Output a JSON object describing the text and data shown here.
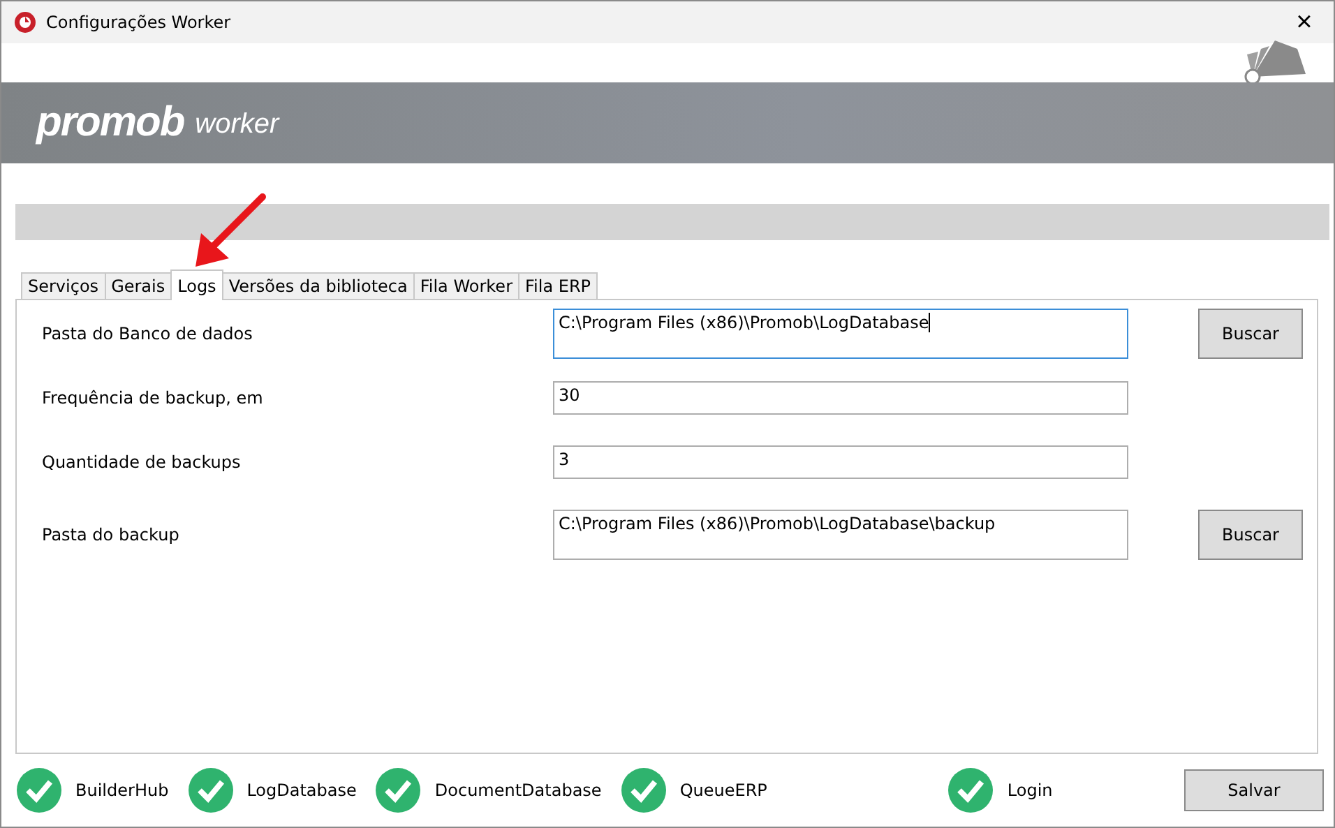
{
  "window": {
    "title": "Configurações Worker",
    "close": "×"
  },
  "banner": {
    "logo": "promob",
    "product": "worker"
  },
  "progress": {
    "level": 0
  },
  "tabs": [
    {
      "label": "Serviços",
      "selected": false
    },
    {
      "label": "Gerais",
      "selected": false
    },
    {
      "label": "Logs",
      "selected": true
    },
    {
      "label": "Versões da biblioteca",
      "selected": false
    },
    {
      "label": "Fila Worker",
      "selected": false
    },
    {
      "label": "Fila ERP",
      "selected": false
    }
  ],
  "fields": [
    {
      "label": "Pasta do Banco de dados",
      "value": "C:\\Program Files (x86)\\Promob\\LogDatabase",
      "focused": true,
      "tall": true,
      "button": "Buscar"
    },
    {
      "label": "Frequência de backup, em",
      "value": "30",
      "focused": false,
      "tall": false
    },
    {
      "label": "Quantidade de backups",
      "value": "3",
      "focused": false,
      "tall": false
    },
    {
      "label": "Pasta do backup",
      "value": "C:\\Program Files (x86)\\Promob\\LogDatabase\\backup",
      "focused": false,
      "tall": true,
      "button": "Buscar"
    }
  ],
  "statuses": [
    {
      "label": "BuilderHub",
      "ok": true
    },
    {
      "label": "LogDatabase",
      "ok": true
    },
    {
      "label": "DocumentDatabase",
      "ok": true
    },
    {
      "label": "QueueERP",
      "ok": true
    },
    {
      "label": "Login",
      "ok": true
    }
  ],
  "save_button": "Salvar"
}
